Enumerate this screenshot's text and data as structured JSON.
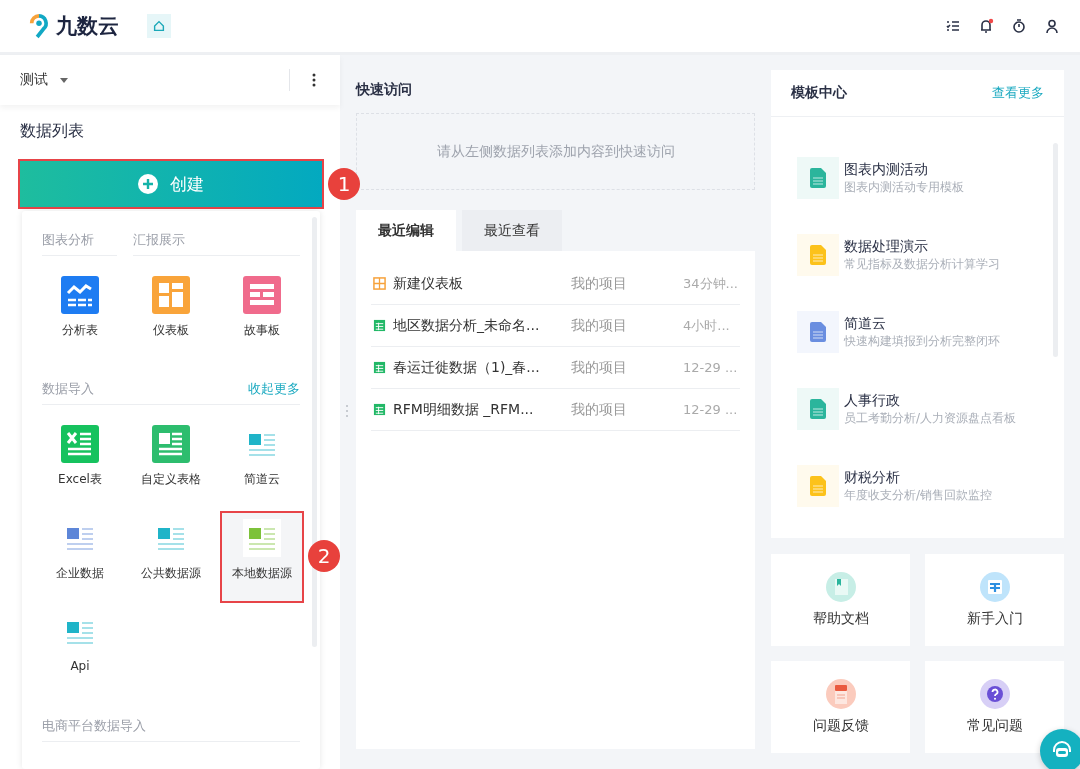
{
  "header": {
    "logo_text": "九数云"
  },
  "sidebar": {
    "project": "测试",
    "title": "数据列表",
    "create_button": {
      "label": "创建",
      "highlighted": true,
      "callout": "1"
    },
    "sections": [
      {
        "headings": [
          "图表分析",
          "汇报展示"
        ],
        "items": [
          {
            "kind": "analysis",
            "label": "分析表",
            "highlighted": false
          },
          {
            "kind": "dashboard",
            "label": "仪表板",
            "highlighted": false
          },
          {
            "kind": "story",
            "label": "故事板",
            "highlighted": false
          }
        ]
      },
      {
        "headings": [
          "数据导入"
        ],
        "link": "收起更多",
        "items": [
          {
            "kind": "excel",
            "label": "Excel表",
            "highlighted": false
          },
          {
            "kind": "custom_table",
            "label": "自定义表格",
            "highlighted": false
          },
          {
            "kind": "jiandaoyun",
            "label": "简道云",
            "highlighted": false
          },
          {
            "kind": "enterprise",
            "label": "企业数据",
            "highlighted": false
          },
          {
            "kind": "public",
            "label": "公共数据源",
            "highlighted": false
          },
          {
            "kind": "local",
            "label": "本地数据源",
            "highlighted": true,
            "callout": "2"
          },
          {
            "kind": "api",
            "label": "Api",
            "highlighted": false
          }
        ]
      },
      {
        "headings": [
          "电商平台数据导入"
        ]
      }
    ]
  },
  "quick_access": {
    "title": "快速访问",
    "empty_text": "请从左侧数据列表添加内容到快速访问"
  },
  "recent": {
    "tabs": [
      {
        "label": "最近编辑",
        "selected": true
      },
      {
        "label": "最近查看",
        "selected": false
      }
    ],
    "rows": [
      {
        "kind": "dashboard",
        "name": "新建仪表板",
        "project": "我的项目",
        "time": "34分钟..."
      },
      {
        "kind": "table",
        "name": "地区数据分析_未命名...",
        "project": "我的项目",
        "time": "4小时..."
      },
      {
        "kind": "table",
        "name": "春运迁徙数据（1)_春...",
        "project": "我的项目",
        "time": "12-29 ..."
      },
      {
        "kind": "table",
        "name": "RFM明细数据 _RFM...",
        "project": "我的项目",
        "time": "12-29 ..."
      }
    ]
  },
  "templates": {
    "title": "模板中心",
    "link": "查看更多",
    "items": [
      {
        "name": "图表内测活动",
        "description": "图表内测活动专用模板",
        "color": "#2bb59c"
      },
      {
        "name": "数据处理演示",
        "description": "常见指标及数据分析计算学习",
        "color": "#fcc21b"
      },
      {
        "name": "简道云",
        "description": "快速构建填报到分析完整闭环",
        "color": "#6a8ee0"
      },
      {
        "name": "人事行政",
        "description": "员工考勤分析/人力资源盘点看板",
        "color": "#2bb59c"
      },
      {
        "name": "财税分析",
        "description": "年度收支分析/销售回款监控",
        "color": "#fcc21b"
      }
    ]
  },
  "shortcuts": [
    {
      "kind": "help",
      "label": "帮助文档"
    },
    {
      "kind": "guide",
      "label": "新手入门"
    },
    {
      "kind": "feedback",
      "label": "问题反馈"
    },
    {
      "kind": "faq",
      "label": "常见问题"
    }
  ]
}
